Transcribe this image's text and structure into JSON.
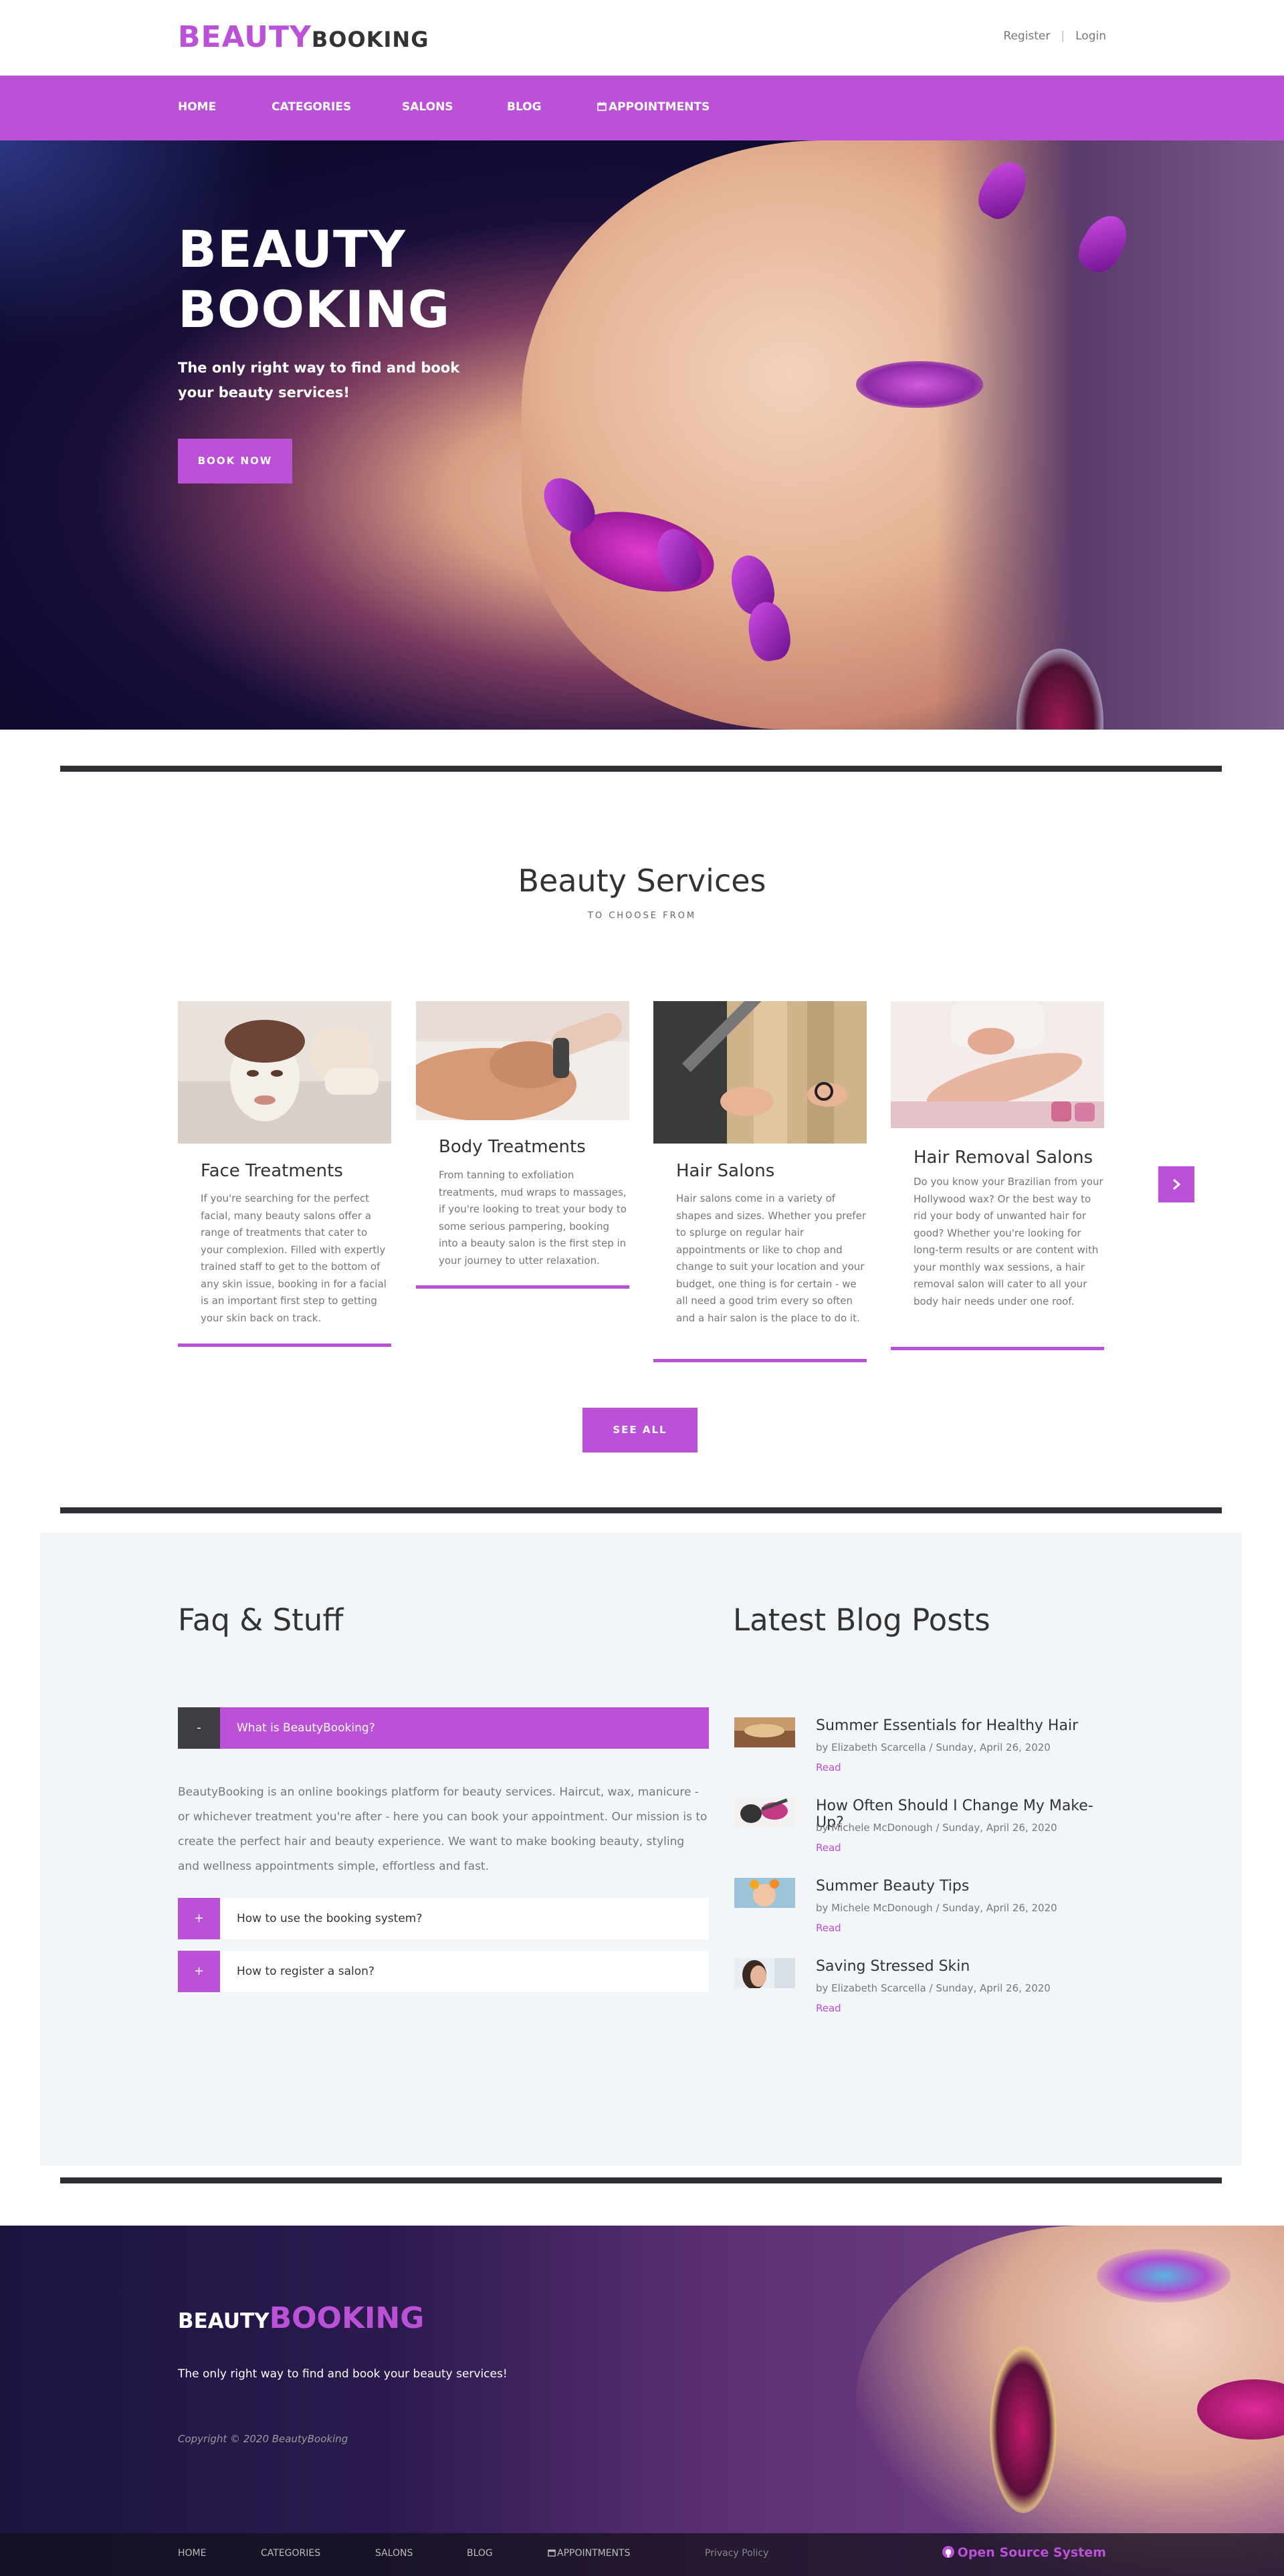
{
  "brand": {
    "part1": "BEAUTY",
    "part2": "BOOKING"
  },
  "auth": {
    "register": "Register",
    "separator": "|",
    "login": "Login"
  },
  "nav": {
    "home": "HOME",
    "categories": "CATEGORIES",
    "salons": "SALONS",
    "blog": "BLOG",
    "appointments": "APPOINTMENTS",
    "calendar_icon": "calendar-icon"
  },
  "hero": {
    "title_line1": "BEAUTY",
    "title_line2": "BOOKING",
    "subtitle": "The only right way to find and book your beauty services!",
    "button": "BOOK NOW"
  },
  "services": {
    "title": "Beauty Services",
    "subtitle": "TO CHOOSE FROM",
    "cards": [
      {
        "title": "Face Treatments",
        "text": "If you're searching for the perfect facial, many beauty salons offer a range of treatments that cater to your complexion. Filled with expertly trained staff to get to the bottom of any skin issue, booking in for a facial is an important first step to getting your skin back on track."
      },
      {
        "title": "Body Treatments",
        "text": "From tanning to exfoliation treatments, mud wraps to massages, if you're looking to treat your body to some serious pampering, booking into a beauty salon is the first step in your journey to utter relaxation."
      },
      {
        "title": "Hair Salons",
        "text": "Hair salons come in a variety of shapes and sizes. Whether you prefer to splurge on regular hair appointments or like to chop and change to suit your location and your budget, one thing is for certain - we all need a good trim every so often and a hair salon is the place to do it."
      },
      {
        "title": "Hair Removal Salons",
        "text": "Do you know your Brazilian from your Hollywood wax? Or the best way to rid your body of unwanted hair for good? Whether you're looking for long-term results or are content with your monthly wax sessions, a hair removal salon will cater to all your body hair needs under one roof."
      }
    ],
    "next_icon": "chevron-right-icon",
    "see_all": "SEE ALL"
  },
  "faq": {
    "title": "Faq & Stuff",
    "items": [
      {
        "toggle": "-",
        "question": "What is BeautyBooking?"
      },
      {
        "toggle": "+",
        "question": "How to use the booking system?"
      },
      {
        "toggle": "+",
        "question": "How to register a salon?"
      }
    ],
    "answer": "BeautyBooking is an online bookings platform for beauty services. Haircut, wax, manicure - or whichever treatment you're after - here you can book your appointment. Our mission is to create the perfect hair and beauty experience. We want to make booking beauty, styling and wellness appointments simple, effortless and fast."
  },
  "blog": {
    "title": "Latest Blog Posts",
    "posts": [
      {
        "title": "Summer Essentials for Healthy Hair",
        "meta": "by Elizabeth Scarcella / Sunday, April 26, 2020",
        "read": "Read"
      },
      {
        "title": "How Often Should I Change My Make-Up?",
        "meta": "by Michele McDonough / Sunday, April 26, 2020",
        "read": "Read"
      },
      {
        "title": "Summer Beauty Tips",
        "meta": "by Michele McDonough / Sunday, April 26, 2020",
        "read": "Read"
      },
      {
        "title": "Saving Stressed Skin",
        "meta": "by Elizabeth Scarcella / Sunday, April 26, 2020",
        "read": "Read"
      }
    ]
  },
  "footer": {
    "brand_part1": "BEAUTY",
    "brand_part2": "BOOKING",
    "tagline": "The only right way to find and book your beauty services!",
    "copyright": "Copyright © 2020 BeautyBooking",
    "links": {
      "home": "HOME",
      "categories": "CATEGORIES",
      "salons": "SALONS",
      "blog": "BLOG",
      "appointments": "APPOINTMENTS",
      "privacy": "Privacy Policy"
    },
    "open_source": "Open Source System",
    "github_icon": "github-icon"
  },
  "colors": {
    "accent": "#bb51d6",
    "dark": "#2d2f35",
    "faq_bg": "#f3f6f9"
  }
}
